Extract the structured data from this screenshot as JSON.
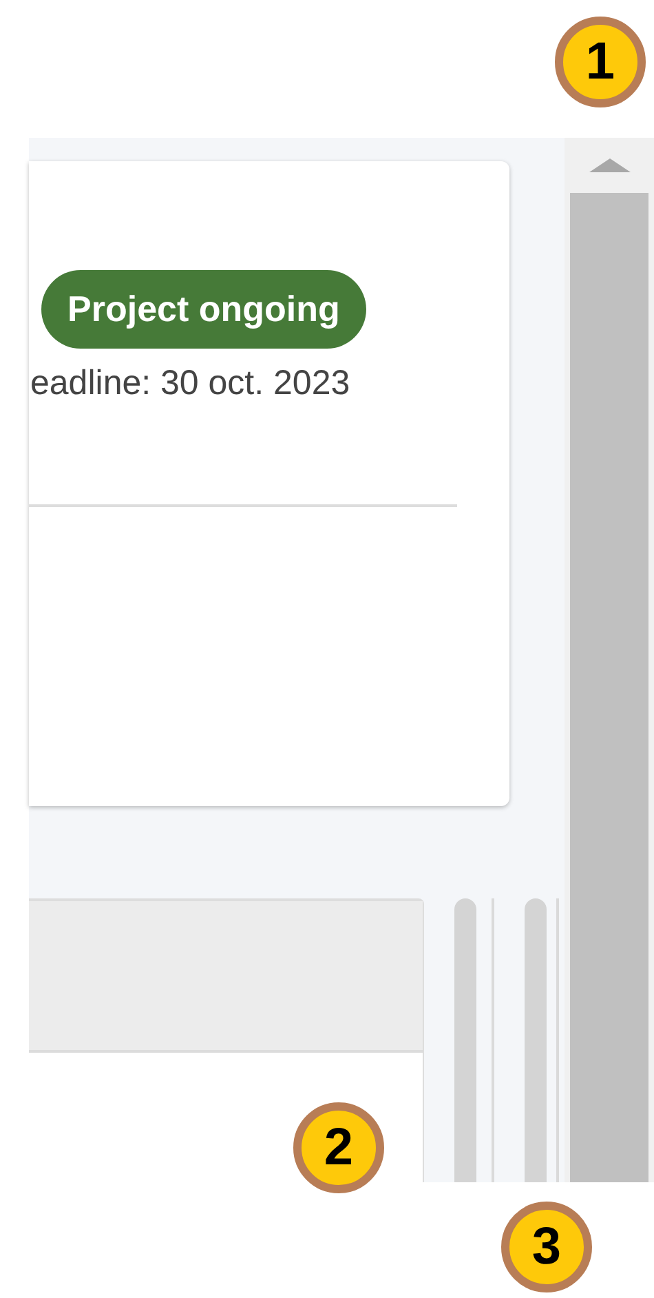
{
  "card": {
    "status_badge": "Project ongoing",
    "deadline": "eadline: 30 oct. 2023"
  },
  "markers": [
    {
      "label": "1"
    },
    {
      "label": "2"
    },
    {
      "label": "3"
    }
  ]
}
